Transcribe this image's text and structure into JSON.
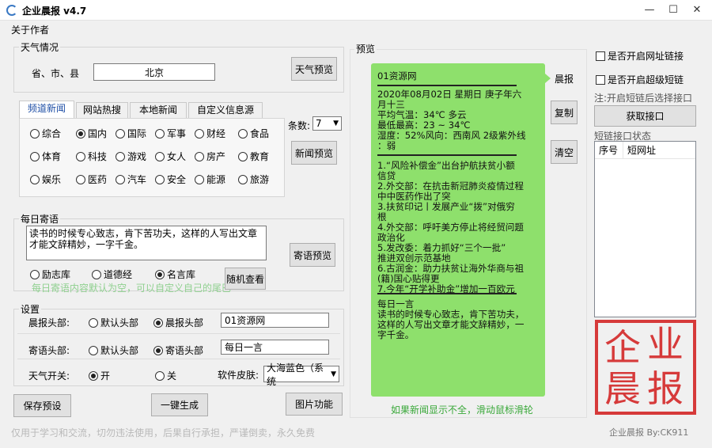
{
  "window": {
    "title": "企业晨报 v4.7",
    "min": "—",
    "max": "☐",
    "close": "✕"
  },
  "menu": {
    "about": "关于作者"
  },
  "weather": {
    "group_title": "天气情况",
    "location_label": "省、市、县",
    "location_value": "北京",
    "preview_button": "天气预览"
  },
  "news": {
    "tabs": [
      "频道新闻",
      "网站热搜",
      "本地新闻",
      "自定义信息源"
    ],
    "active_tab": 0,
    "categories": [
      "综合",
      "国内",
      "国际",
      "军事",
      "财经",
      "食品",
      "体育",
      "科技",
      "游戏",
      "女人",
      "房产",
      "教育",
      "娱乐",
      "医药",
      "汽车",
      "安全",
      "能源",
      "旅游"
    ],
    "selected": "国内",
    "count_label": "条数:",
    "count_value": "7",
    "preview_button": "新闻预览"
  },
  "quote": {
    "group_title": "每日寄语",
    "text": "读书的时候专心致志，肯下苦功夫，这样的人写出文章才能文辞精妙，一字千金。",
    "sources": [
      "励志库",
      "道德经",
      "名言库"
    ],
    "selected": "名言库",
    "hint": "每日寄语内容默认为空，可以自定义自己的尾巴",
    "preview_button": "寄语预览",
    "random_button": "随机查看"
  },
  "settings": {
    "group_title": "设置",
    "header_label": "晨报头部:",
    "header_options": [
      "默认头部",
      "晨报头部"
    ],
    "header_selected": "晨报头部",
    "header_value": "01资源网",
    "quote_label": "寄语头部:",
    "quote_options": [
      "默认头部",
      "寄语头部"
    ],
    "quote_selected": "寄语头部",
    "quote_value": "每日一言",
    "weather_label": "天气开关:",
    "weather_options": [
      "开",
      "关"
    ],
    "weather_selected": "开",
    "skin_label": "软件皮肤:",
    "skin_value": "大海蓝色（系统"
  },
  "buttons": {
    "save": "保存预设",
    "generate": "一键生成",
    "image": "图片功能"
  },
  "preview": {
    "group_title": "预览",
    "header": "01资源网",
    "date_lines": [
      "2020年08月02日   星期日   庚子年六",
      "月十三"
    ],
    "weather_lines": [
      "平均气温：34℃  多云",
      "最低最高：23  ~  34℃",
      "湿度：52%风向：西南风  2级紫外线",
      "：弱"
    ],
    "news_lines": [
      "1.“风险补偿金”出台护航扶贫小额",
      "信贷",
      "2.外交部：在抗击新冠肺炎疫情过程",
      "中中医药作出了突",
      "3.扶贫印记丨发展产业“拨”对俄穷",
      "根",
      "4.外交部：呼吁美方停止将经贸问题",
      "政治化",
      "5.发改委：着力抓好“三个一批”",
      "推进双创示范基地",
      "6.古润金：助力扶贫让海外华商与祖",
      "(籍)国心贴得更",
      "7.今年“开学补助金”增加一百欧元"
    ],
    "quote_title": "每日一言",
    "quote_lines": [
      "读书的时候专心致志，肯下苦功夫，",
      "这样的人写出文章才能文辞精妙，一",
      "字千金。"
    ],
    "side_buttons": [
      "晨报",
      "复制",
      "清空"
    ],
    "scroll_hint": "如果新闻显示不全，滑动鼠标滑轮"
  },
  "right": {
    "open_link": "是否开启网址链接",
    "open_short": "是否开启超级短链",
    "note": "注:开启短链后选择接口",
    "get_api": "获取接口",
    "status_label": "短链接口状态",
    "col_no": "序号",
    "col_url": "短网址",
    "stamp_chars": [
      "企",
      "业",
      "晨",
      "报"
    ]
  },
  "footer": {
    "left": "仅用于学习和交流，切勿违法使用，后果自行承担，严谨倒卖，永久免费",
    "right": "企业晨报 By:CK911"
  }
}
